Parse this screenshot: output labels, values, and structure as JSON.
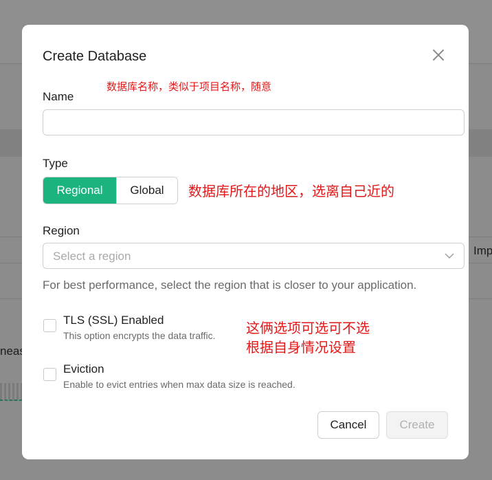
{
  "background": {
    "right_text": "Imp",
    "left_text": "neas"
  },
  "dialog": {
    "title": "Create Database",
    "close_icon": "close-icon",
    "name": {
      "label": "Name",
      "value": "",
      "placeholder": ""
    },
    "type": {
      "label": "Type",
      "options": [
        "Regional",
        "Global"
      ],
      "selected": "Regional"
    },
    "region": {
      "label": "Region",
      "placeholder": "Select a region",
      "help": "For best performance, select the region that is closer to your application."
    },
    "options": [
      {
        "title": "TLS (SSL) Enabled",
        "description": "This option encrypts the data traffic.",
        "checked": false
      },
      {
        "title": "Eviction",
        "description": "Enable to evict entries when max data size is reached.",
        "checked": false
      }
    ],
    "buttons": {
      "cancel": "Cancel",
      "create": "Create"
    }
  },
  "annotations": {
    "name_note": "数据库名称，类似于项目名称，随意",
    "type_note": "数据库所在的地区，选离自己近的",
    "options_note_line1": "这俩选项可选可不选",
    "options_note_line2": "根据自身情况设置"
  },
  "colors": {
    "accent": "#1bb47f",
    "annotation": "#e0191a",
    "overlay": "#8c8c8c"
  }
}
